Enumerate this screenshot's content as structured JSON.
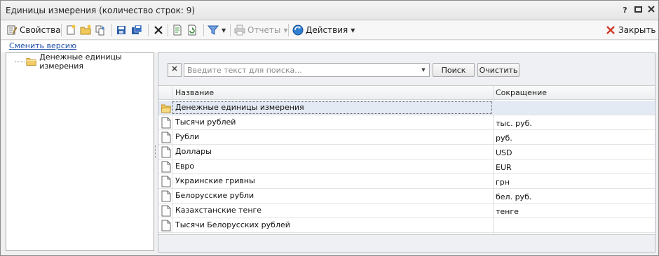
{
  "window": {
    "title": "Единицы измерения (количество строк: 9)",
    "help": "?"
  },
  "toolbar": {
    "properties_label": "Свойства",
    "reports_label": "Отчеты",
    "actions_label": "Действия",
    "close_label": "Закрыть"
  },
  "version_link": "Сменить версию",
  "tree": {
    "items": [
      {
        "label": "Денежные единицы измерения"
      }
    ]
  },
  "search": {
    "placeholder": "Введите текст для поиска...",
    "value": "",
    "search_button": "Поиск",
    "clear_button": "Очистить"
  },
  "grid": {
    "columns": [
      "Название",
      "Сокращение"
    ],
    "rows": [
      {
        "name": "Денежные единицы измерения",
        "abbr": "",
        "type": "folder"
      },
      {
        "name": "Тысячи рублей",
        "abbr": "тыс. руб.",
        "type": "doc"
      },
      {
        "name": "Рубли",
        "abbr": "руб.",
        "type": "doc"
      },
      {
        "name": "Доллары",
        "abbr": "USD",
        "type": "doc"
      },
      {
        "name": "Евро",
        "abbr": "EUR",
        "type": "doc"
      },
      {
        "name": "Украинские гривны",
        "abbr": "грн",
        "type": "doc"
      },
      {
        "name": "Белорусские рубли",
        "abbr": "бел. руб.",
        "type": "doc"
      },
      {
        "name": "Казахстанские тенге",
        "abbr": "тенге",
        "type": "doc"
      },
      {
        "name": "Тысячи Белорусских рублей",
        "abbr": "",
        "type": "doc"
      }
    ]
  },
  "colors": {
    "link": "#1f4fa8",
    "selected_row": "#e4eaf3",
    "close_x": "#d23a2a"
  }
}
